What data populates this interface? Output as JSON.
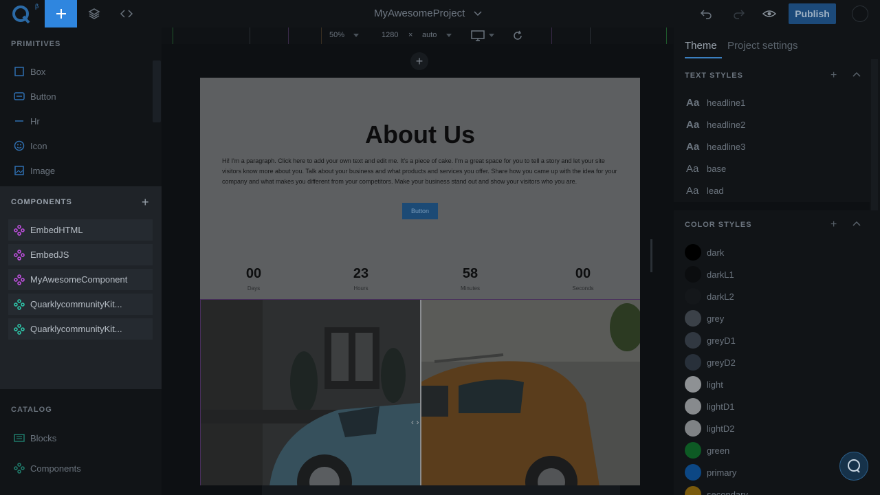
{
  "topbar": {
    "logo_badge": "β",
    "project_title": "MyAwesomeProject",
    "publish_label": "Publish"
  },
  "sidebar": {
    "primitives_title": "PRIMITIVES",
    "primitives": [
      {
        "label": "Box",
        "icon": "box-icon"
      },
      {
        "label": "Button",
        "icon": "button-icon"
      },
      {
        "label": "Hr",
        "icon": "hr-icon"
      },
      {
        "label": "Icon",
        "icon": "smiley-icon"
      },
      {
        "label": "Image",
        "icon": "image-icon"
      }
    ],
    "components_title": "COMPONENTS",
    "components": [
      {
        "label": "EmbedHTML",
        "color": "#c04fe0"
      },
      {
        "label": "EmbedJS",
        "color": "#c04fe0"
      },
      {
        "label": "MyAwesomeComponent",
        "color": "#c04fe0"
      },
      {
        "label": "QuarklycommunityKit...",
        "color": "#2ec4a8"
      },
      {
        "label": "QuarklycommunityKit...",
        "color": "#2ec4a8"
      }
    ],
    "catalog_title": "CATALOG",
    "catalog": [
      {
        "label": "Blocks",
        "icon": "blocks-icon"
      },
      {
        "label": "Components",
        "icon": "components-icon"
      }
    ]
  },
  "canvas_toolbar": {
    "zoom": "50%",
    "width": "1280",
    "times": "×",
    "height": "auto"
  },
  "page": {
    "heading": "About Us",
    "paragraph": "Hi! I'm a paragraph. Click here to add your own text and edit me. It's a piece of cake. I'm a great space for you to tell a story and let your site visitors know more about you. Talk about your business and what products and services you offer. Share how you came up with the idea for your company and what makes you different from your competitors. Make your business stand out and show your visitors who you are.",
    "button_label": "Button",
    "timer": [
      {
        "value": "00",
        "label": "Days"
      },
      {
        "value": "23",
        "label": "Hours"
      },
      {
        "value": "58",
        "label": "Minutes"
      },
      {
        "value": "00",
        "label": "Seconds"
      }
    ]
  },
  "right_panel": {
    "tab_theme": "Theme",
    "tab_project_settings": "Project settings",
    "text_styles_title": "TEXT STYLES",
    "text_styles": [
      {
        "label": "headline1",
        "aa": "Aa",
        "bold": true
      },
      {
        "label": "headline2",
        "aa": "Aa",
        "bold": true
      },
      {
        "label": "headline3",
        "aa": "Aa",
        "bold": true
      },
      {
        "label": "base",
        "aa": "Aa",
        "bold": false
      },
      {
        "label": "lead",
        "aa": "Aa",
        "bold": false
      }
    ],
    "color_styles_title": "COLOR STYLES",
    "color_styles": [
      {
        "label": "dark",
        "color": "#000000"
      },
      {
        "label": "darkL1",
        "color": "#0b0d0f"
      },
      {
        "label": "darkL2",
        "color": "#14171a"
      },
      {
        "label": "grey",
        "color": "#3b4148"
      },
      {
        "label": "greyD1",
        "color": "#313841"
      },
      {
        "label": "greyD2",
        "color": "#28303a"
      },
      {
        "label": "light",
        "color": "#8e9194"
      },
      {
        "label": "lightD1",
        "color": "#878a8d"
      },
      {
        "label": "lightD2",
        "color": "#7f8285"
      },
      {
        "label": "green",
        "color": "#0d5a24"
      },
      {
        "label": "primary",
        "color": "#0c4784"
      },
      {
        "label": "secondary",
        "color": "#7a5a0c"
      }
    ]
  }
}
